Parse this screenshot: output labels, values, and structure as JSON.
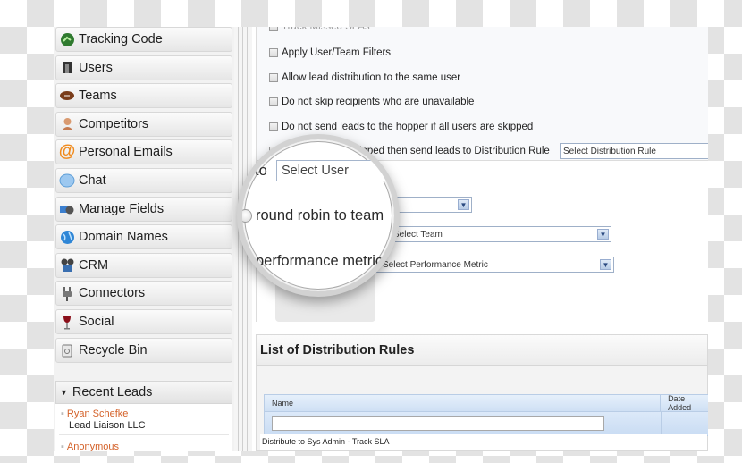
{
  "sidebar": {
    "items": [
      {
        "label": "Tracking Code",
        "icon": "tracking-code-icon"
      },
      {
        "label": "Users",
        "icon": "users-icon"
      },
      {
        "label": "Teams",
        "icon": "teams-icon"
      },
      {
        "label": "Competitors",
        "icon": "competitors-icon"
      },
      {
        "label": "Personal Emails",
        "icon": "at-sign-icon"
      },
      {
        "label": "Chat",
        "icon": "chat-bubble-icon"
      },
      {
        "label": "Manage Fields",
        "icon": "manage-fields-icon"
      },
      {
        "label": "Domain Names",
        "icon": "globe-icon"
      },
      {
        "label": "CRM",
        "icon": "crm-icon"
      },
      {
        "label": "Connectors",
        "icon": "plug-icon"
      },
      {
        "label": "Social",
        "icon": "social-icon"
      },
      {
        "label": "Recycle Bin",
        "icon": "recycle-bin-icon"
      }
    ],
    "recent_leads": {
      "title": "Recent Leads",
      "items": [
        {
          "name": "Ryan Schefke",
          "company": "Lead Liaison LLC"
        },
        {
          "name": "Anonymous",
          "company": ""
        }
      ]
    }
  },
  "options": {
    "partial_top": "Track Missed SLAs",
    "checkboxes": [
      {
        "label": "Apply User/Team Filters",
        "checked": false
      },
      {
        "label": "Allow lead distribution to the same user",
        "checked": false
      },
      {
        "label": "Do not skip recipients who are unavailable",
        "checked": false
      },
      {
        "label": "Do not send leads to the hopper if all users are skipped",
        "checked": false
      },
      {
        "label": "If all users are skipped then send leads to Distribution Rule",
        "checked": false
      }
    ],
    "distribution_rule_select": "Select Distribution Rule"
  },
  "assign": {
    "to_label": "to",
    "select_user": "Select User",
    "round_robin_label": "round robin to team",
    "select_team": "Select Team",
    "performance_label": "performance metric",
    "select_metric": "Select Performance Metric"
  },
  "rules": {
    "title": "List of Distribution Rules",
    "columns": [
      "Name",
      "Date Added"
    ],
    "rows": [
      {
        "name": "Distribute to Sys Admin - Track SLA",
        "date_added": ""
      }
    ]
  }
}
